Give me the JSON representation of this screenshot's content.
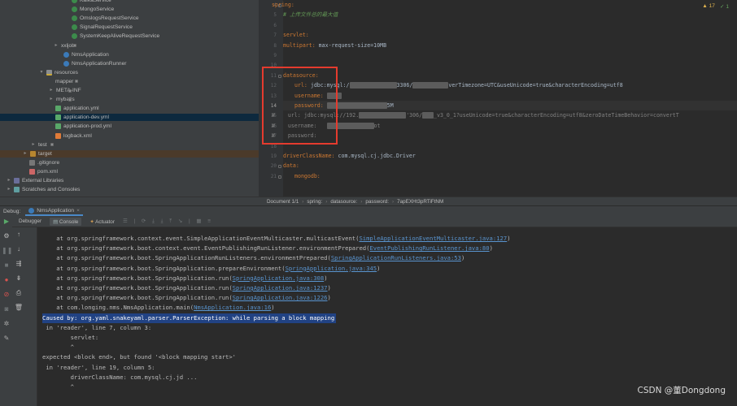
{
  "project_tree": {
    "items": [
      {
        "label": "KafkaService",
        "icon": "class-icon"
      },
      {
        "label": "MongoService",
        "icon": "class-icon"
      },
      {
        "label": "OmslogsRequestService",
        "icon": "class-icon"
      },
      {
        "label": "SignalRequestService",
        "icon": "class-icon"
      },
      {
        "label": "SystemKeepAliveRequestService",
        "icon": "class-icon"
      },
      {
        "label": "xxljob",
        "icon": "folder-icon"
      },
      {
        "label": "NmsApplication",
        "icon": "app-icon"
      },
      {
        "label": "NmsApplicationRunner",
        "icon": "app-icon"
      },
      {
        "label": "resources",
        "icon": "resources-folder-icon"
      },
      {
        "label": "mapper",
        "icon": "folder-icon"
      },
      {
        "label": "META-INF",
        "icon": "folder-icon"
      },
      {
        "label": "mybatis",
        "icon": "folder-icon"
      },
      {
        "label": "application.yml",
        "icon": "yaml-icon"
      },
      {
        "label": "application-dev.yml",
        "icon": "yaml-icon"
      },
      {
        "label": "application-prod.yml",
        "icon": "yaml-icon"
      },
      {
        "label": "logback.xml",
        "icon": "xml-icon"
      },
      {
        "label": "test",
        "icon": "folder-icon"
      },
      {
        "label": "target",
        "icon": "target-folder-icon"
      },
      {
        "label": ".gitignore",
        "icon": "gitignore-icon"
      },
      {
        "label": "pom.xml",
        "icon": "maven-icon"
      },
      {
        "label": "External Libraries",
        "icon": "libraries-icon"
      },
      {
        "label": "Scratches and Consoles",
        "icon": "scratches-icon"
      }
    ]
  },
  "editor": {
    "line_numbers": [
      "4",
      "5",
      "6",
      "7",
      "8",
      "9",
      "10",
      "11",
      "12",
      "13",
      "14",
      "15",
      "16",
      "17",
      "18",
      "19",
      "20",
      "21"
    ],
    "current_line": "14",
    "lines": [
      {
        "key": "spring:",
        "rest": ""
      },
      {
        "comment": "# 上传文件总的最大值"
      },
      {
        "key": "",
        "rest": ""
      },
      {
        "key": "servlet:",
        "rest": ""
      },
      {
        "key": "multipart:",
        "rest": " max-request-size=10MB"
      },
      {
        "key": "",
        "rest": ""
      },
      {
        "key": "",
        "rest": ""
      },
      {
        "key": "datasource:",
        "rest": ""
      },
      {
        "key": "url:",
        "rest": " jdbc:mysql:/",
        "tail": "3306/",
        "tail2": "verTimezone=UTC&useUnicode=true&characterEncoding=utf8"
      },
      {
        "key": "username:",
        "rest": " "
      },
      {
        "key": "password:",
        "rest": " ",
        "tail": "5M"
      },
      {
        "comment": "#    url: jdbc:mysql://192.",
        "ctail": "'306/",
        "ctail2": "_v3_0_1?useUnicode=true&characterEncoding=utf8&zeroDateTimeBehavior=convertT"
      },
      {
        "comment": "#    username:   ",
        "ctail": "ot"
      },
      {
        "comment": "#    password:"
      },
      {
        "key": "",
        "rest": ""
      },
      {
        "key": "driverClassName:",
        "rest": " com.mysql.cj.jdbc.Driver"
      },
      {
        "key": "data:",
        "rest": ""
      },
      {
        "key": "mongodb:",
        "rest": ""
      }
    ],
    "inspection": {
      "warnings": "▲ 17",
      "ok": "✓ 1"
    }
  },
  "breadcrumb": {
    "items": [
      "Document 1/1",
      "spring:",
      "datasource:",
      "password:",
      "7apEXHt3pRTiFtNM"
    ],
    "separator": "›"
  },
  "debug": {
    "label": "Debug:",
    "run_config": "NmsApplication",
    "close": "×",
    "tabs": [
      "Debugger",
      "Console",
      "Actuator"
    ]
  },
  "console": {
    "lines": [
      {
        "text": "    at org.springframework.context.event.SimpleApplicationEventMulticaster.multicastEvent(",
        "link": "SimpleApplicationEventMulticaster.java:127",
        "end": ")"
      },
      {
        "text": "    at org.springframework.boot.context.event.EventPublishingRunListener.environmentPrepared(",
        "link": "EventPublishingRunListener.java:80",
        "end": ")"
      },
      {
        "text": "    at org.springframework.boot.SpringApplicationRunListeners.environmentPrepared(",
        "link": "SpringApplicationRunListeners.java:53",
        "end": ")"
      },
      {
        "text": "    at org.springframework.boot.SpringApplication.prepareEnvironment(",
        "link": "SpringApplication.java:345",
        "end": ")"
      },
      {
        "text": "    at org.springframework.boot.SpringApplication.run(",
        "link": "SpringApplication.java:308",
        "end": ")"
      },
      {
        "text": "    at org.springframework.boot.SpringApplication.run(",
        "link": "SpringApplication.java:1237",
        "end": ")"
      },
      {
        "text": "    at org.springframework.boot.SpringApplication.run(",
        "link": "SpringApplication.java:1226",
        "end": ")"
      },
      {
        "text": "    at com.longing.nms.NmsApplication.main(",
        "link": "NmsApplication.java:16",
        "end": ")"
      },
      {
        "text": "Caused by: org.yaml.snakeyaml.parser.ParserException: while parsing a block mapping",
        "highlight": true
      },
      {
        "text": " in 'reader', line 7, column 3:"
      },
      {
        "text": "        servlet:"
      },
      {
        "text": "        ^"
      },
      {
        "text": "expected <block end>, but found '<block mapping start>'"
      },
      {
        "text": " in 'reader', line 19, column 5:"
      },
      {
        "text": "        driverClassName: com.mysql.cj.jd ..."
      },
      {
        "text": "        ^"
      }
    ]
  },
  "watermark": "CSDN @董Dongdong",
  "colors": {
    "ide_background": "#2b2b2b",
    "panel_background": "#3c3f41",
    "yaml_key": "#cc7832",
    "comment": "#808080",
    "link": "#5994cf",
    "highlight": "#214283",
    "annotation_box": "#e53b2e"
  }
}
